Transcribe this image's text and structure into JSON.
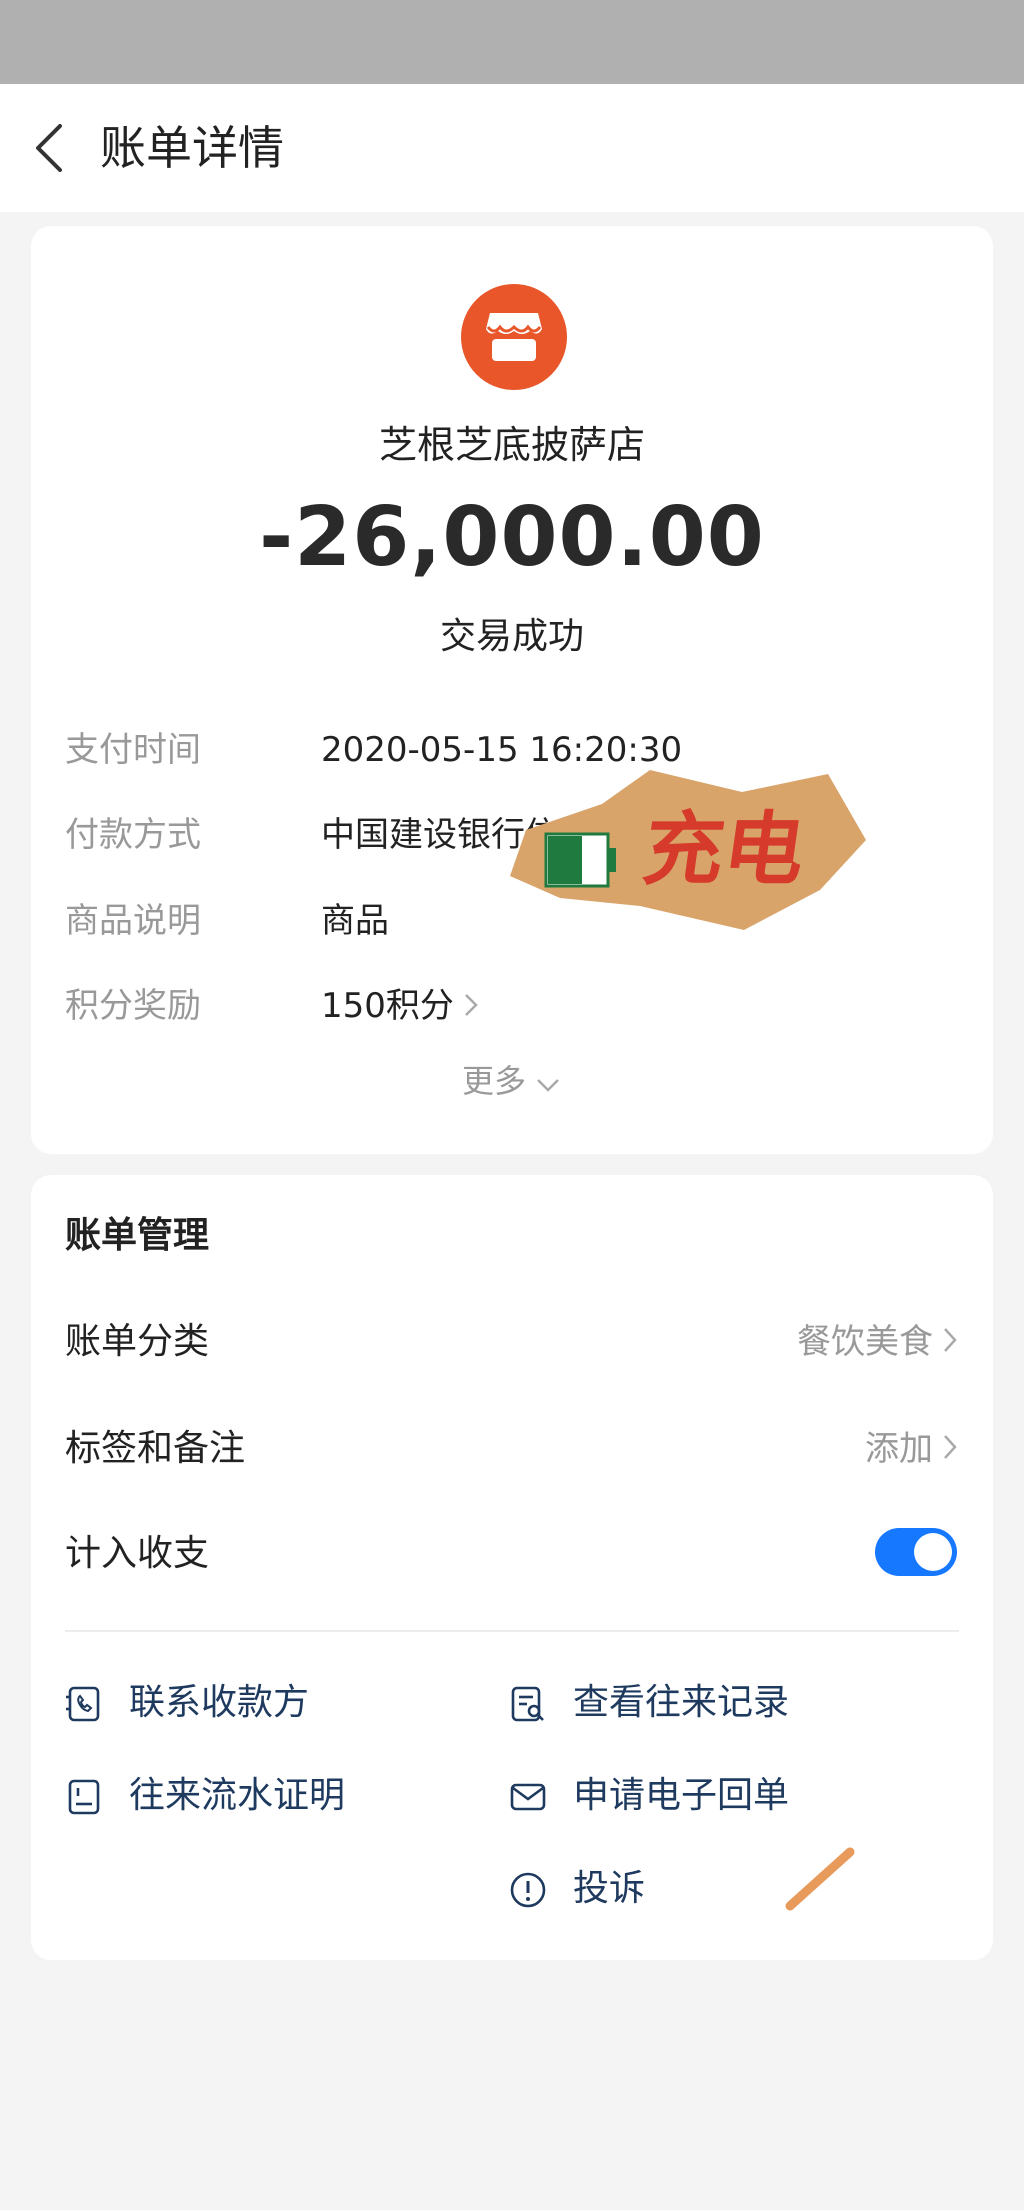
{
  "header": {
    "title": "账单详情"
  },
  "bill": {
    "merchant": "芝根芝底披萨店",
    "amount": "-26,000.00",
    "status": "交易成功",
    "details": [
      {
        "label": "支付时间",
        "value": "2020-05-15 16:20:30"
      },
      {
        "label": "付款方式",
        "value": "中国建设银行信"
      },
      {
        "label": "商品说明",
        "value": "商品"
      },
      {
        "label": "积分奖励",
        "value": "150积分"
      }
    ],
    "more_label": "更多"
  },
  "sticker": {
    "text": "充电"
  },
  "management": {
    "title": "账单管理",
    "category": {
      "label": "账单分类",
      "value": "餐饮美食"
    },
    "tags": {
      "label": "标签和备注",
      "value": "添加"
    },
    "include": {
      "label": "计入收支",
      "enabled": true
    },
    "actions": {
      "contact": "联系收款方",
      "records": "查看往来记录",
      "proof": "往来流水证明",
      "receipt": "申请电子回单",
      "complaint": "投诉"
    }
  },
  "colors": {
    "accent": "#1677ff",
    "logo": "#e8562a",
    "action_text": "#1f3a5f"
  },
  "icons": {
    "back": "chevron-left-icon",
    "logo": "storefront-icon",
    "contact": "phone-icon",
    "records": "document-search-icon",
    "proof": "document-icon",
    "receipt": "mail-icon",
    "complaint": "alert-circle-icon"
  }
}
